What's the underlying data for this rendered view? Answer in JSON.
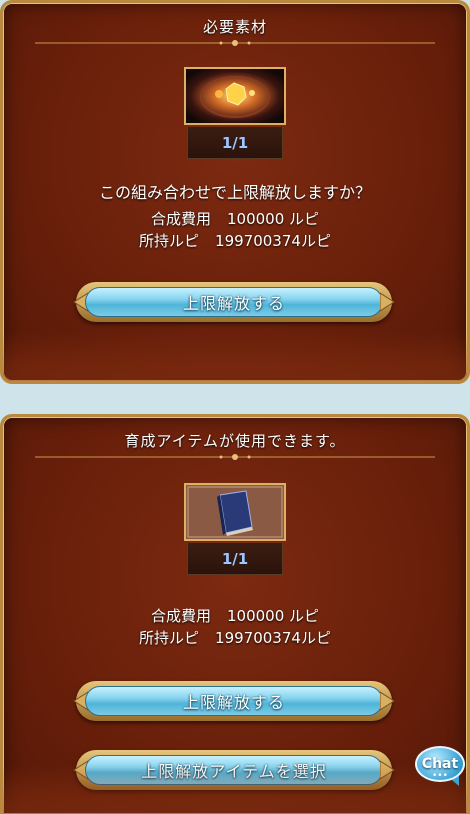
{
  "panel1": {
    "title": "必要素材",
    "item_icon": "gold-crystal-item-icon",
    "count": "1/1",
    "question": "この組み合わせで上限解放しますか？",
    "cost_label": "合成費用",
    "cost_value": "100000 ルピ",
    "owned_label": "所持ルピ",
    "owned_value": "199700374ルピ",
    "button_label": "上限解放する"
  },
  "panel2": {
    "title": "育成アイテムが使用できます。",
    "item_icon": "blue-book-item-icon",
    "count": "1/1",
    "cost_label": "合成費用",
    "cost_value": "100000 ルピ",
    "owned_label": "所持ルピ",
    "owned_value": "199700374ルピ",
    "button_label": "上限解放する",
    "select_button_label": "上限解放アイテムを選択"
  },
  "chat": {
    "label": "Chat",
    "dots": "•••"
  },
  "colors": {
    "panel_bg": "#6a200b",
    "panel_border": "#b98a3e",
    "count_text": "#9cc6ff",
    "button_blue": "#86d3ee"
  }
}
